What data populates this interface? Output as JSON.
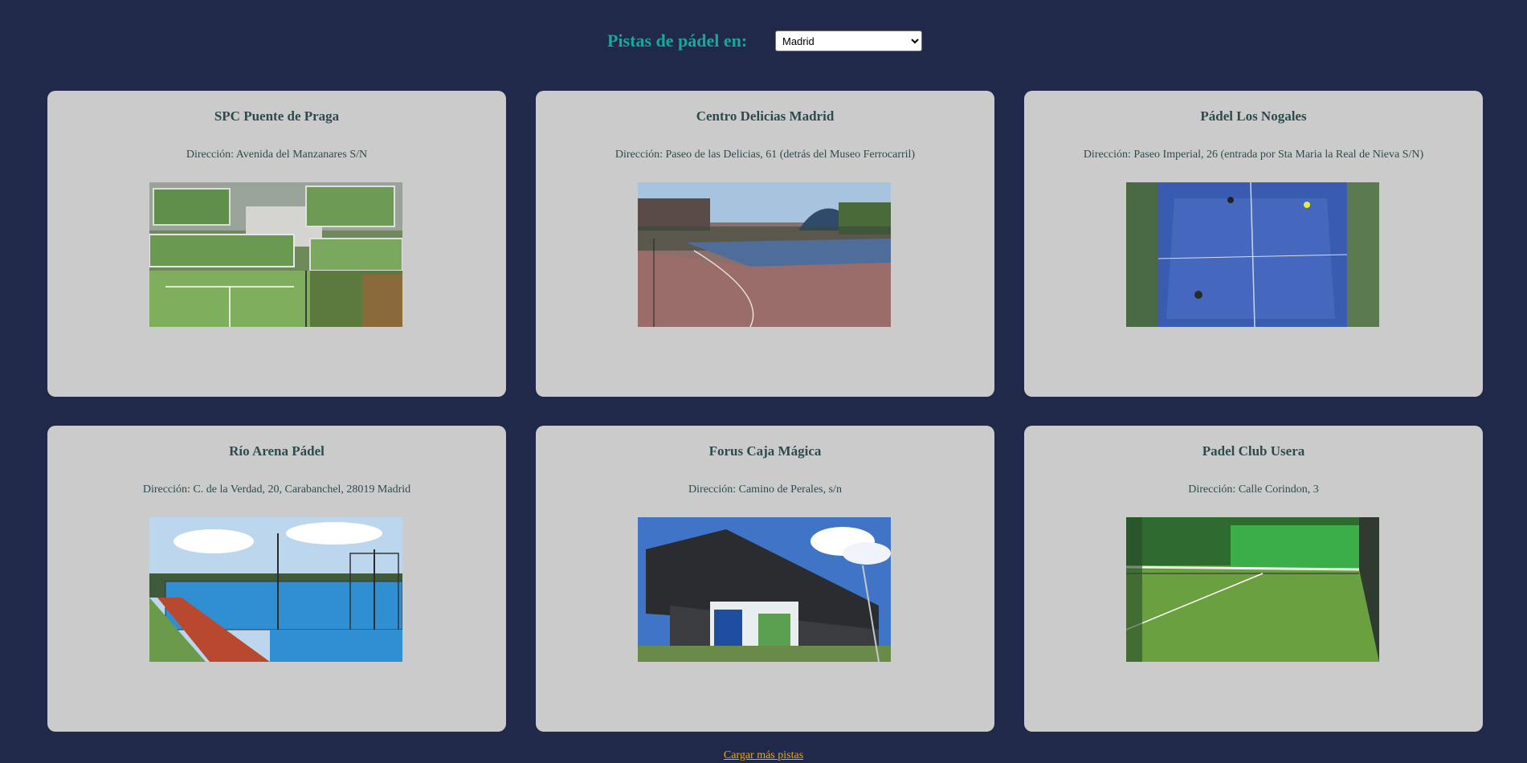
{
  "header": {
    "title": "Pistas de pádel en:",
    "city_selected": "Madrid"
  },
  "courts": [
    {
      "name": "SPC Puente de Praga",
      "address": "Dirección: Avenida del Manzanares S/N",
      "photo": "aerial-green-courts-photo"
    },
    {
      "name": "Centro Delicias Madrid",
      "address": "Dirección: Paseo de las Delicias, 61 (detrás del Museo Ferrocarril)",
      "photo": "outdoor-red-blue-courts-photo"
    },
    {
      "name": "Pádel Los Nogales",
      "address": "Dirección: Paseo Imperial, 26 (entrada por Sta Maria la Real de Nieva S/N)",
      "photo": "blue-court-overhead-photo"
    },
    {
      "name": "Río Arena Pádel",
      "address": "Dirección: C. de la Verdad, 20, Carabanchel, 28019 Madrid",
      "photo": "blue-courts-sunny-photo"
    },
    {
      "name": "Forus Caja Mágica",
      "address": "Dirección: Camino de Perales, s/n",
      "photo": "forus-building-photo"
    },
    {
      "name": "Padel Club Usera",
      "address": "Dirección: Calle Corindon, 3",
      "photo": "green-court-net-photo"
    }
  ],
  "footer": {
    "load_more": "Cargar más pistas"
  },
  "colors": {
    "background": "#21294a",
    "title": "#17a89a",
    "card": "#cbcbcb",
    "card_text": "#2e4a4e",
    "link": "#f2a900"
  }
}
